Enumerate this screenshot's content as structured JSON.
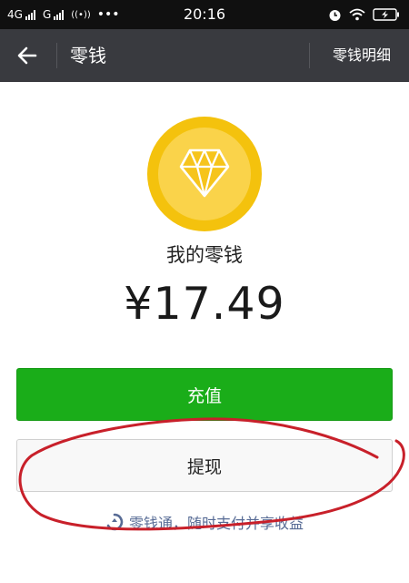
{
  "status_bar": {
    "network_1": "4G",
    "network_2": "G",
    "time": "20:16"
  },
  "nav": {
    "title": "零钱",
    "right_link": "零钱明细",
    "back_icon": "arrow-left-icon",
    "background": "#393a3f"
  },
  "wallet": {
    "coin_icon": "diamond-coin-icon",
    "label": "我的零钱",
    "balance": "¥17.49"
  },
  "buttons": {
    "recharge": "充值",
    "withdraw": "提现"
  },
  "footer": {
    "icon": "lingqiantong-icon",
    "link": "零钱通，随时支付并享收益"
  },
  "colors": {
    "accent_green": "#1aad19",
    "link_blue": "#576b95",
    "coin_yellow": "#f4c20d",
    "annotation_red": "#c8202a"
  }
}
